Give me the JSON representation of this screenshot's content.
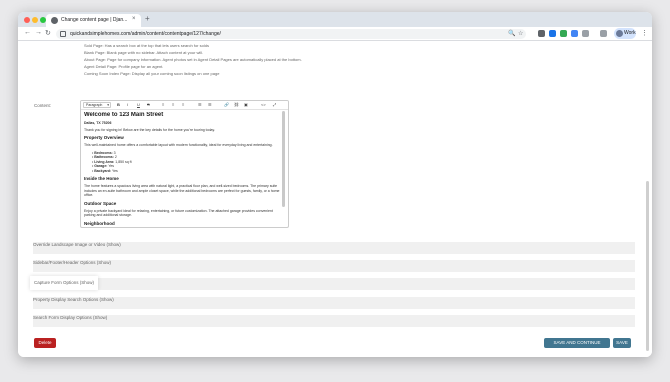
{
  "browser": {
    "tab_title": "Change content page | Djan...",
    "tab_close": "×",
    "tab_new": "+",
    "back": "←",
    "forward": "→",
    "reload": "↻",
    "url": "quickandsimplehomes.com/admin/content/contentpage/127/change/",
    "zoom_icon": "🔍",
    "star_icon": "☆",
    "profile_label": "Work",
    "menu": "⋮"
  },
  "help_text": [
    "Sold Page: Has a search box at the top that lets users search for solds",
    "Blank Page: Blank page with no sidebar. Attach content at your will.",
    "About Page: Page for company information. Agent photos set in Agent Detail Pages are automatically placed at the bottom.",
    "Agent Detail Page: Profile page for an agent.",
    "Coming Soon Index Page: Display all your coming soon listings on one page"
  ],
  "content_field": {
    "label": "Content:",
    "format_select": "Paragraph",
    "toolbar_buttons": [
      "B",
      "I",
      "U",
      "S",
      "≡",
      "≡",
      "≡",
      "☰",
      "☰",
      "🔗",
      "⛓",
      "▣",
      "<>",
      "⤢"
    ],
    "heading": "Welcome to 123 Main Street",
    "location": "Dallas, TX 75206",
    "intro": "Thank you for signing in! Below are the key details for the home you're touring today.",
    "overview_title": "Property Overview",
    "overview_text": "This well-maintained home offers a comfortable layout with modern functionality, ideal for everyday living and entertaining.",
    "facts": [
      {
        "key": "Bedrooms:",
        "value": " 3"
      },
      {
        "key": "Bathrooms:",
        "value": " 2"
      },
      {
        "key": "Living Area:",
        "value": " 1,850 sq ft"
      },
      {
        "key": "Garage:",
        "value": " Yes"
      },
      {
        "key": "Backyard:",
        "value": " Yes"
      }
    ],
    "inside_title": "Inside the Home",
    "inside_text": "The home features a spacious living area with natural light, a practical floor plan, and well-sized bedrooms. The primary suite includes an en-suite bathroom and ample closet space, while the additional bedrooms are perfect for guests, family, or a home office.",
    "outdoor_title": "Outdoor Space",
    "outdoor_text": "Enjoy a private backyard ideal for relaxing, entertaining, or future customization. The attached garage provides convenient parking and additional storage.",
    "more_title": "Neighborhood"
  },
  "collapsibles": [
    "Override Landscape Image or Video (Show)",
    "Sidebar/Footer/Header Options (Show)",
    "Capture Form Options (Show)",
    "Property Display Search Options (Show)",
    "Search Form Display Options (Show)"
  ],
  "actions": {
    "delete": "Delete",
    "save_continue": "SAVE AND CONTINUE EDITING",
    "save": "SAVE"
  },
  "colors": {
    "delete_bg": "#ba2121",
    "save_bg": "#417690"
  }
}
